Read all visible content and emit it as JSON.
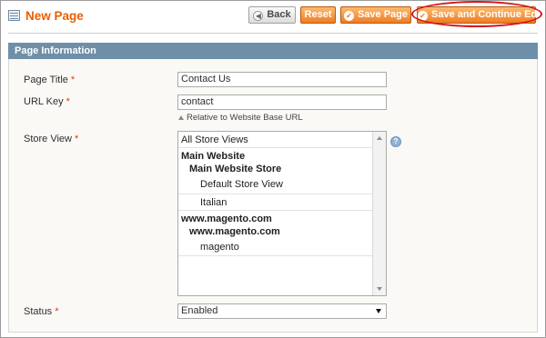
{
  "header": {
    "title": "New Page",
    "buttons": {
      "back": "Back",
      "reset": "Reset",
      "save": "Save Page",
      "save_continue": "Save and Continue Edit"
    }
  },
  "section": {
    "title": "Page Information"
  },
  "fields": {
    "page_title": {
      "label": "Page Title",
      "required_mark": "*",
      "value": "Contact Us"
    },
    "url_key": {
      "label": "URL Key",
      "required_mark": "*",
      "value": "contact",
      "hint": "Relative to Website Base URL"
    },
    "store_view": {
      "label": "Store View",
      "required_mark": "*",
      "options": [
        {
          "text": "All Store Views",
          "kind": "option",
          "indent": 0
        },
        {
          "text": "Main Website",
          "kind": "group",
          "indent": 0
        },
        {
          "text": "Main Website Store",
          "kind": "group",
          "indent": 1
        },
        {
          "text": "Default Store View",
          "kind": "option",
          "indent": 2
        },
        {
          "text": "Italian",
          "kind": "option",
          "indent": 2
        },
        {
          "text": "www.magento.com",
          "kind": "group",
          "indent": 0
        },
        {
          "text": "www.magento.com",
          "kind": "group",
          "indent": 1
        },
        {
          "text": "magento",
          "kind": "option",
          "indent": 2
        }
      ],
      "help_icon": "help-icon"
    },
    "status": {
      "label": "Status",
      "required_mark": "*",
      "value": "Enabled"
    }
  },
  "colors": {
    "accent": "#eb5e00",
    "button": "#ee7d24",
    "section_head": "#6f8fa8",
    "highlight": "#d3151d",
    "required": "#eb340a"
  }
}
